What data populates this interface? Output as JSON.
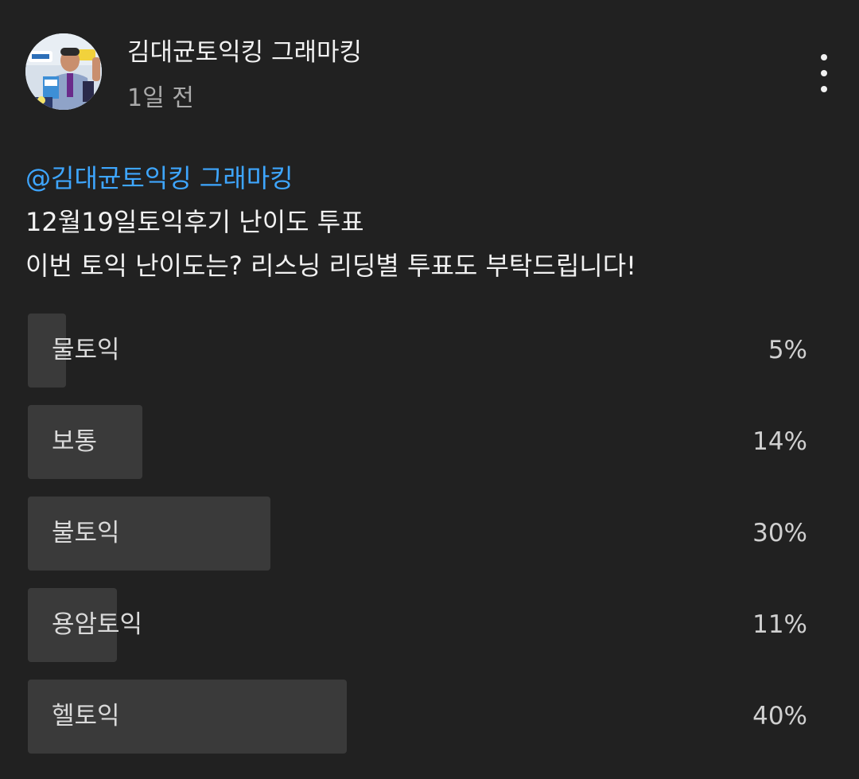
{
  "post": {
    "channel_name": "김대균토익킹 그래마킹",
    "time_ago": "1일 전",
    "mention": "@김대균토익킹 그래마킹",
    "line1": "12월19일토익후기 난이도 투표",
    "line2": "이번 토익 난이도는? 리스닝 리딩별 투표도 부탁드립니다!",
    "menu_icon": "more-vert-icon"
  },
  "poll": {
    "fill_color": "#3a3a3a",
    "options": [
      {
        "label": "물토익",
        "percent_text": "5%",
        "fraction": 0.047
      },
      {
        "label": "보통",
        "percent_text": "14%",
        "fraction": 0.142
      },
      {
        "label": "불토익",
        "percent_text": "30%",
        "fraction": 0.3
      },
      {
        "label": "용암토익",
        "percent_text": "11%",
        "fraction": 0.11
      },
      {
        "label": "헬토익",
        "percent_text": "40%",
        "fraction": 0.395
      }
    ]
  },
  "colors": {
    "background": "#212121",
    "mention": "#3ea6ff",
    "secondary_text": "#aaaaaa"
  }
}
